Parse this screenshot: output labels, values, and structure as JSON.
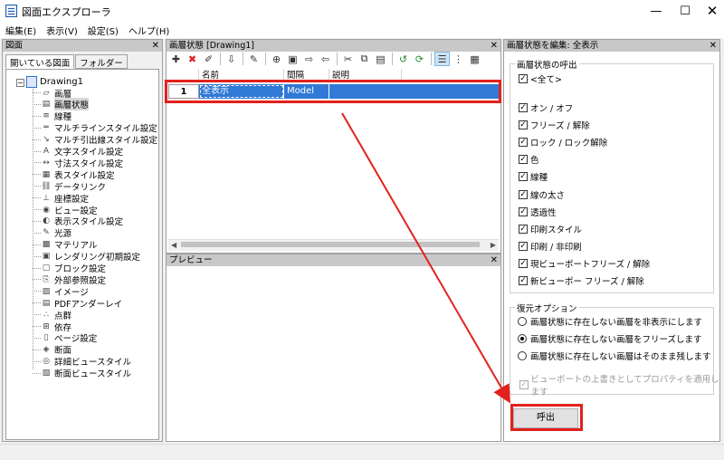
{
  "window": {
    "title": "図面エクスプローラ",
    "controls": {
      "minimize": "—",
      "maximize": "☐",
      "close": "✕"
    }
  },
  "menu": [
    "編集(E)",
    "表示(V)",
    "設定(S)",
    "ヘルプ(H)"
  ],
  "left_panel": {
    "title": "図面",
    "close": "✕",
    "tabs": [
      "開いている図面",
      "フォルダー"
    ],
    "tree_root": {
      "expander": "−",
      "label": "Drawing1"
    },
    "items": [
      {
        "label": "画層",
        "icon": "layer-icon"
      },
      {
        "label": "画層状態",
        "icon": "layer-state-icon",
        "selected": true
      },
      {
        "label": "線種",
        "icon": "linetype-icon"
      },
      {
        "label": "マルチラインスタイル設定",
        "icon": "multiline-style-icon"
      },
      {
        "label": "マルチ引出線スタイル設定",
        "icon": "mleader-style-icon"
      },
      {
        "label": "文字スタイル設定",
        "icon": "text-style-icon"
      },
      {
        "label": "寸法スタイル設定",
        "icon": "dim-style-icon"
      },
      {
        "label": "表スタイル設定",
        "icon": "table-style-icon"
      },
      {
        "label": "データリンク",
        "icon": "data-link-icon"
      },
      {
        "label": "座標設定",
        "icon": "ucs-icon"
      },
      {
        "label": "ビュー設定",
        "icon": "view-icon"
      },
      {
        "label": "表示スタイル設定",
        "icon": "visual-style-icon"
      },
      {
        "label": "光源",
        "icon": "light-icon"
      },
      {
        "label": "マテリアル",
        "icon": "material-icon"
      },
      {
        "label": "レンダリング初期設定",
        "icon": "render-preset-icon"
      },
      {
        "label": "ブロック設定",
        "icon": "block-icon"
      },
      {
        "label": "外部参照設定",
        "icon": "xref-icon"
      },
      {
        "label": "イメージ",
        "icon": "image-icon"
      },
      {
        "label": "PDFアンダーレイ",
        "icon": "pdf-underlay-icon"
      },
      {
        "label": "点群",
        "icon": "point-cloud-icon"
      },
      {
        "label": "依存",
        "icon": "dependency-icon"
      },
      {
        "label": "ページ設定",
        "icon": "page-setup-icon"
      },
      {
        "label": "断面",
        "icon": "section-icon"
      },
      {
        "label": "詳細ビュースタイル",
        "icon": "detail-view-style-icon"
      },
      {
        "label": "断面ビュースタイル",
        "icon": "section-view-style-icon"
      }
    ]
  },
  "center_panel": {
    "title": "画層状態 [Drawing1]",
    "close": "✕",
    "toolbar_icons": [
      "new-icon",
      "delete-icon",
      "brush-icon",
      "sep",
      "import-icon",
      "sep",
      "edit-icon",
      "sep",
      "new-from-icon",
      "save-state-icon",
      "export-icon",
      "import-state-icon",
      "sep",
      "cut-icon",
      "copy-icon",
      "paste-icon",
      "sep",
      "restore-icon",
      "refresh-icon",
      "sep",
      "details-view-icon",
      "list-view-icon",
      "icon-view-icon"
    ],
    "columns": [
      "",
      "名前",
      "間隔",
      "説明"
    ],
    "rows": [
      {
        "num": "1",
        "name": "全表示",
        "space": "Model",
        "description": ""
      }
    ]
  },
  "preview_panel": {
    "title": "プレビュー",
    "close": "✕"
  },
  "right_panel": {
    "title": "画層状態を編集: 全表示",
    "close": "✕",
    "recall_group": {
      "title": "画層状態の呼出",
      "all": "<全て>",
      "options": [
        "オン / オフ",
        "フリーズ / 解除",
        "ロック / ロック解除",
        "色",
        "線種",
        "線の太さ",
        "透過性",
        "印刷スタイル",
        "印刷 / 非印刷",
        "現ビューポートフリーズ / 解除",
        "新ビューポー フリーズ / 解除"
      ]
    },
    "restore_group": {
      "title": "復元オプション",
      "radios": [
        {
          "label": "画層状態に存在しない画層を非表示にします",
          "checked": false
        },
        {
          "label": "画層状態に存在しない画層をフリーズします",
          "checked": true
        },
        {
          "label": "画層状態に存在しない画層はそのまま残します",
          "checked": false
        }
      ],
      "viewport_override": "ビューポートの上書きとしてプロパティを適用します"
    },
    "recall_button": "呼出"
  },
  "annotation_color": "#e2211c"
}
